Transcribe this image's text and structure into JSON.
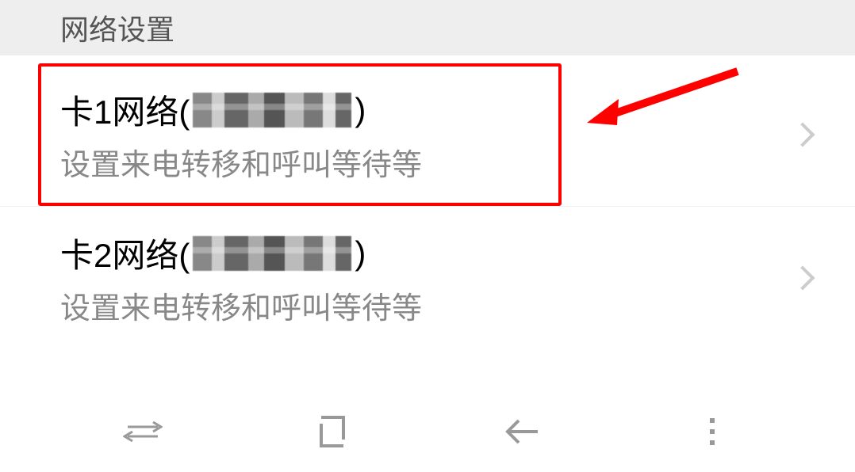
{
  "section": {
    "header": "网络设置"
  },
  "items": [
    {
      "title_prefix": "卡1网络(",
      "title_suffix": ")",
      "subtitle": "设置来电转移和呼叫等待等"
    },
    {
      "title_prefix": "卡2网络(",
      "title_suffix": ")",
      "subtitle": "设置来电转移和呼叫等待等"
    }
  ]
}
